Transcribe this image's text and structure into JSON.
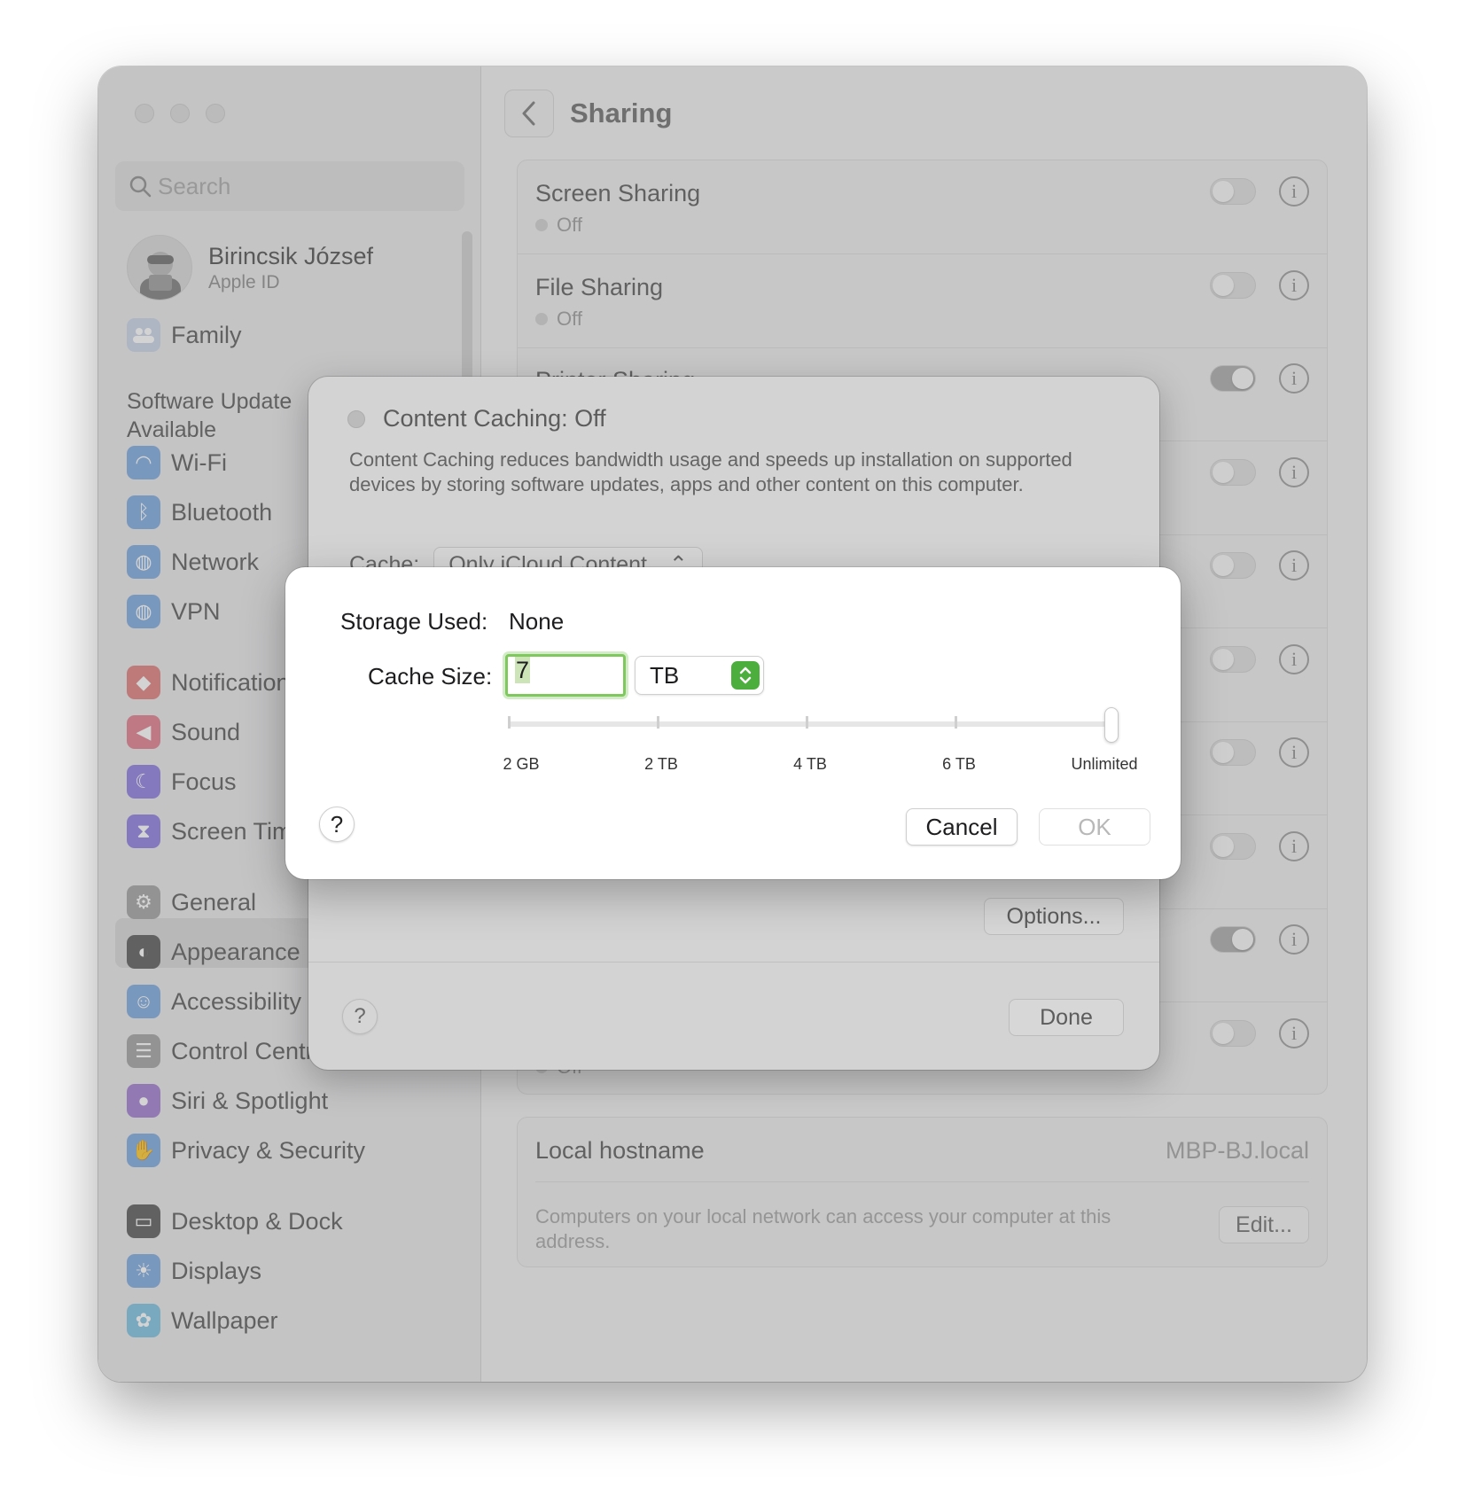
{
  "sidebar": {
    "search_placeholder": "Search",
    "profile": {
      "name": "Birincsik József",
      "subtitle": "Apple ID"
    },
    "family": "Family",
    "update_notice": "Software Update Available",
    "items": [
      {
        "label": "Wi-Fi",
        "icon": "wifi-icon",
        "color": "#7aa7e0"
      },
      {
        "label": "Bluetooth",
        "icon": "bluetooth-icon",
        "color": "#7aa7e0"
      },
      {
        "label": "Network",
        "icon": "globe-icon",
        "color": "#7aa7e0"
      },
      {
        "label": "VPN",
        "icon": "vpn-globe-icon",
        "color": "#7aa7e0"
      },
      {
        "label": "Notifications",
        "icon": "bell-icon",
        "color": "#e07a7a"
      },
      {
        "label": "Sound",
        "icon": "speaker-icon",
        "color": "#e07a8a"
      },
      {
        "label": "Focus",
        "icon": "moon-icon",
        "color": "#8a7ae0"
      },
      {
        "label": "Screen Time",
        "icon": "hourglass-icon",
        "color": "#8a7ae0"
      },
      {
        "label": "General",
        "icon": "gear-icon",
        "color": "#a0a0a0"
      },
      {
        "label": "Appearance",
        "icon": "appearance-icon",
        "color": "#555555"
      },
      {
        "label": "Accessibility",
        "icon": "accessibility-icon",
        "color": "#7aa7e0"
      },
      {
        "label": "Control Centre",
        "icon": "control-centre-icon",
        "color": "#a0a0a0"
      },
      {
        "label": "Siri & Spotlight",
        "icon": "siri-icon",
        "color": "#a07ad0"
      },
      {
        "label": "Privacy & Security",
        "icon": "hand-icon",
        "color": "#7aa7e0"
      },
      {
        "label": "Desktop & Dock",
        "icon": "desktop-icon",
        "color": "#555555"
      },
      {
        "label": "Displays",
        "icon": "sun-icon",
        "color": "#7aa7e0"
      },
      {
        "label": "Wallpaper",
        "icon": "flower-icon",
        "color": "#7ac0e0"
      }
    ]
  },
  "header": {
    "title": "Sharing"
  },
  "sharing_rows": [
    {
      "title": "Screen Sharing",
      "status": "Off",
      "on": false
    },
    {
      "title": "File Sharing",
      "status": "Off",
      "on": false
    },
    {
      "title": "Printer Sharing",
      "status": "",
      "on": true
    },
    {
      "title": "",
      "status": "",
      "on": false
    },
    {
      "title": "",
      "status": "",
      "on": false
    },
    {
      "title": "",
      "status": "",
      "on": false
    },
    {
      "title": "",
      "status": "",
      "on": false
    },
    {
      "title": "",
      "status": "",
      "on": false
    },
    {
      "title": "",
      "status": "",
      "on": true
    },
    {
      "title": "",
      "status": "Off",
      "on": false
    }
  ],
  "hostname": {
    "label": "Local hostname",
    "value": "MBP-BJ.local",
    "description": "Computers on your local network can access your computer at this address.",
    "edit_label": "Edit..."
  },
  "content_caching": {
    "title": "Content Caching: Off",
    "description": "Content Caching reduces bandwidth usage and speeds up installation on supported devices by storing software updates, apps and other content on this computer.",
    "cache_label": "Cache:",
    "cache_value": "Only iCloud Content",
    "options_label": "Options...",
    "done_label": "Done",
    "help_label": "?"
  },
  "cache_dialog": {
    "storage_label": "Storage Used:",
    "storage_value": "None",
    "size_label": "Cache Size:",
    "size_value": "7",
    "unit": "TB",
    "slider_value_fraction": 1.0,
    "ticks": [
      "2 GB",
      "2 TB",
      "4 TB",
      "6 TB",
      "Unlimited"
    ],
    "help_label": "?",
    "cancel_label": "Cancel",
    "ok_label": "OK"
  },
  "window_help_label": "?"
}
